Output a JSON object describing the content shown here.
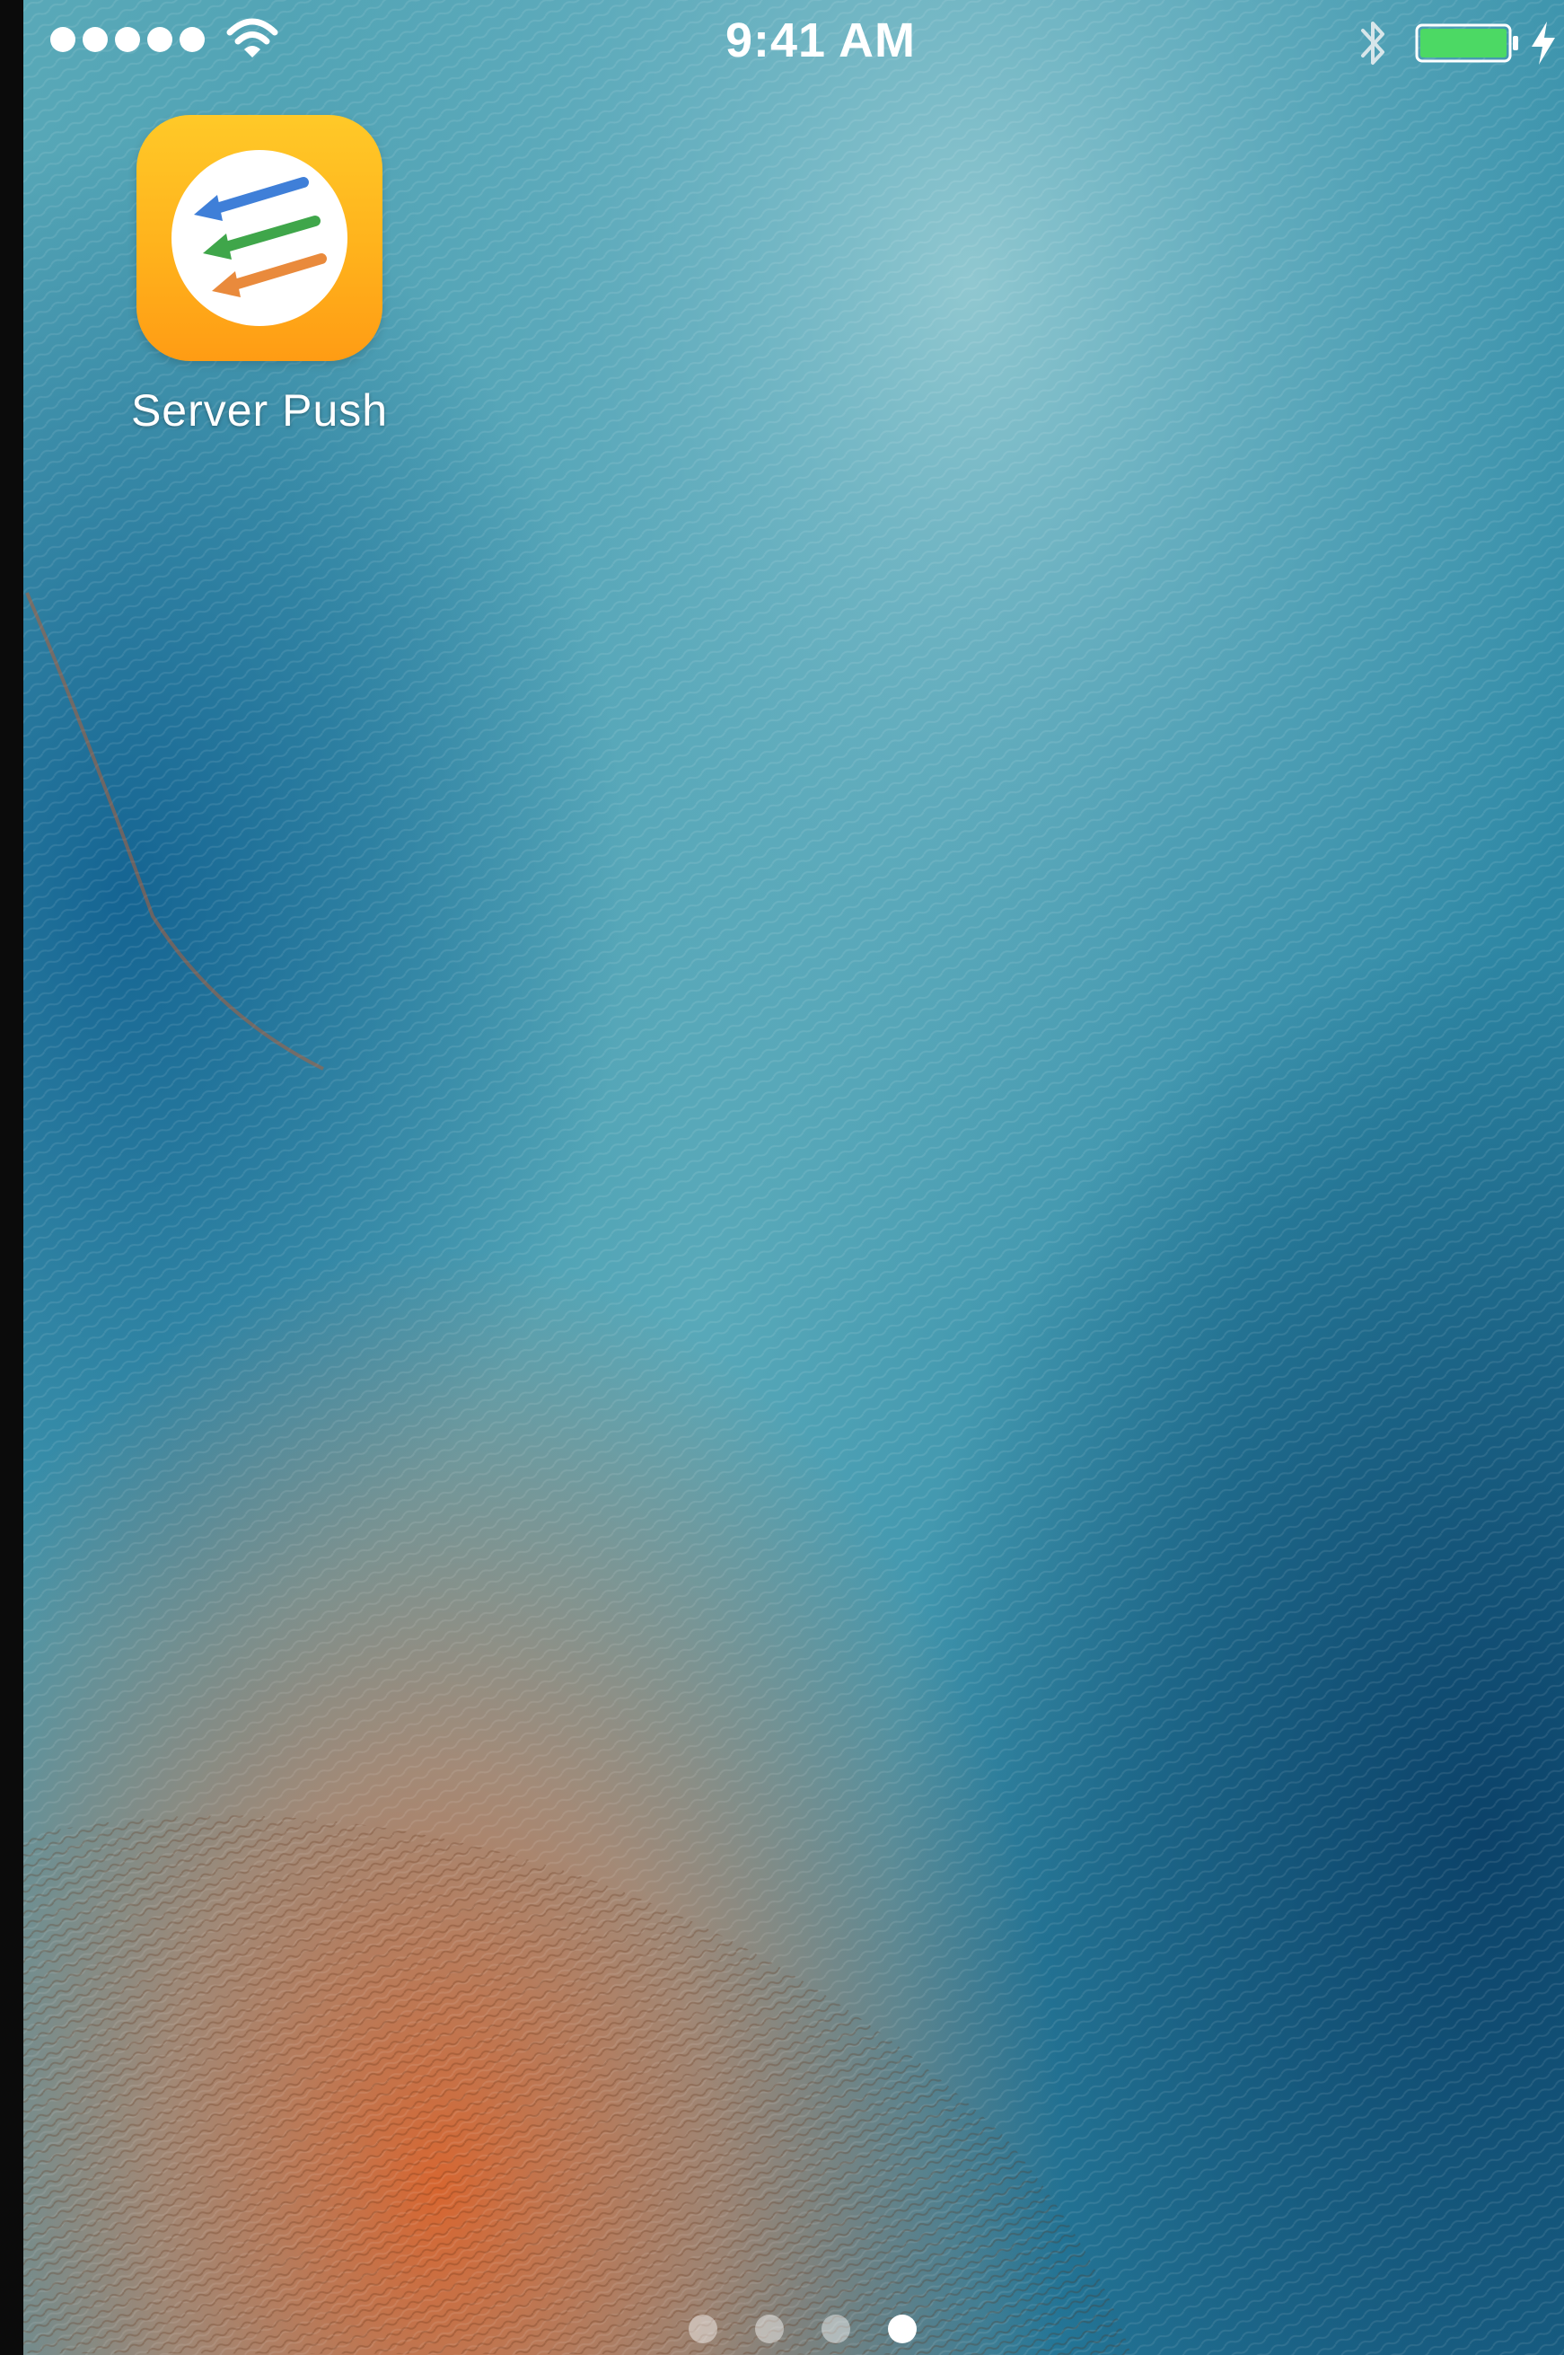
{
  "status_bar": {
    "time": "9:41 AM",
    "signal_bars": 5,
    "battery_level": 1.0,
    "battery_color": "#4cd964",
    "icons": [
      "signal-dots-icon",
      "wifi-icon",
      "bluetooth-icon",
      "battery-icon",
      "charging-bolt-icon"
    ]
  },
  "home_screen": {
    "apps": [
      {
        "label": "Server Push",
        "icon": "server-push-app-icon",
        "icon_colors": [
          "#ffc928",
          "#ff9c14"
        ],
        "arrow_colors": [
          "#3f7fd8",
          "#3fa64a",
          "#e98a3c"
        ]
      }
    ],
    "page_count": 4,
    "current_page": 4
  }
}
